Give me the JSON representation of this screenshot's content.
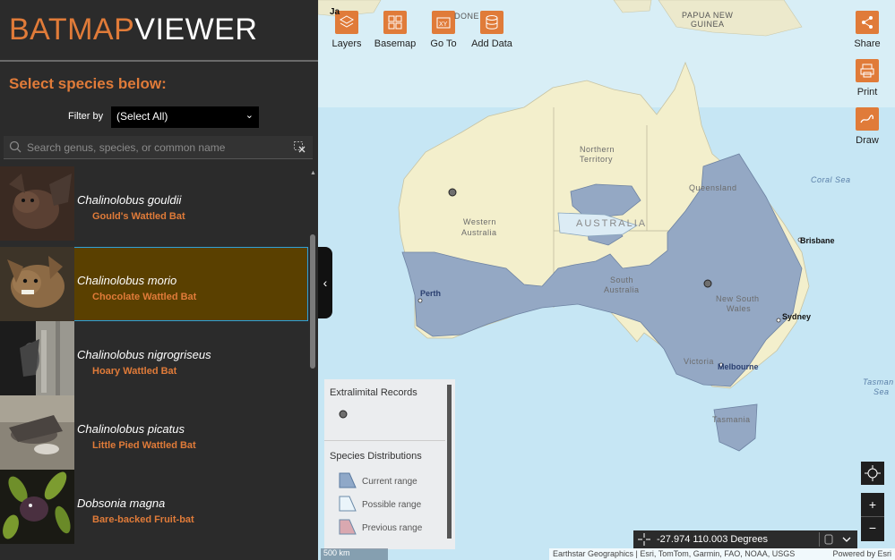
{
  "logo": {
    "part1": "BATMAP",
    "part2": "VIEWER"
  },
  "panel": {
    "select_title": "Select  species below:",
    "filter_label": "Filter by",
    "filter_value": "(Select All)",
    "search_placeholder": "Search genus, species, or common name"
  },
  "species": [
    {
      "scientific": "Chalinolobus gouldii",
      "common": "Gould's Wattled Bat",
      "selected": false
    },
    {
      "scientific": "Chalinolobus morio",
      "common": "Chocolate Wattled Bat",
      "selected": true
    },
    {
      "scientific": "Chalinolobus nigrogriseus",
      "common": "Hoary Wattled Bat",
      "selected": false
    },
    {
      "scientific": "Chalinolobus picatus",
      "common": "Little Pied Wattled Bat",
      "selected": false
    },
    {
      "scientific": "Dobsonia magna",
      "common": "Bare-backed Fruit-bat",
      "selected": false
    }
  ],
  "toolbar": {
    "layers": "Layers",
    "basemap": "Basemap",
    "goto": "Go To",
    "add_data": "Add Data",
    "share": "Share",
    "print": "Print",
    "draw": "Draw"
  },
  "map_labels": {
    "papua": "PAPUA NEW",
    "guinea": "GUINEA",
    "indonesia_frag": "DONE",
    "jakarta_frag": "Ja",
    "nt1": "Northern",
    "nt2": "Territory",
    "qld": "Queensland",
    "wa1": "Western",
    "wa2": "Australia",
    "australia": "AUSTRALIA",
    "sa1": "South",
    "sa2": "Australia",
    "nsw1": "New South",
    "nsw2": "Wales",
    "vic": "Victoria",
    "tas": "Tasmania",
    "coral_sea": "Coral Sea",
    "tasman1": "Tasman",
    "tasman2": "Sea"
  },
  "cities": {
    "brisbane": "Brisbane",
    "sydney": "Sydney",
    "melbourne": "Melbourne",
    "perth": "Perth"
  },
  "legend": {
    "extralimital_title": "Extralimital Records",
    "distributions_title": "Species Distributions",
    "current": "Current range",
    "possible": "Possible range",
    "previous": "Previous range"
  },
  "coordinates": "-27.974 110.003 Degrees",
  "attribution": "Earthstar Geographics | Esri, TomTom, Garmin, FAO, NOAA, USGS",
  "powered_by": "Powered by Esri",
  "scale_label": "500 km",
  "colors": {
    "accent": "#e07b39",
    "current_range": "#8fa8c8",
    "possible_range": "#dcecf5",
    "previous_range": "#d9a8b0",
    "selected_bg": "#5a4000"
  }
}
